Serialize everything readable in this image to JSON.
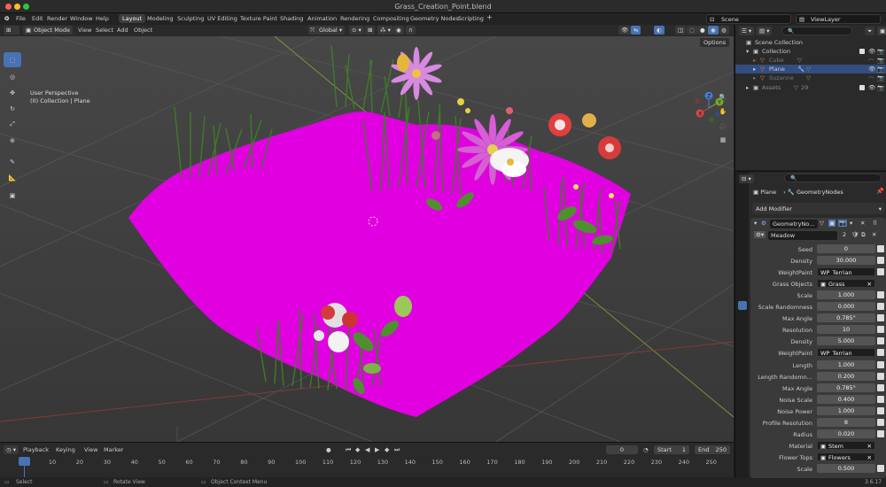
{
  "window": {
    "title": "Grass_Creation_Point.blend"
  },
  "menu": [
    "File",
    "Edit",
    "Render",
    "Window",
    "Help"
  ],
  "workspaces": [
    "Layout",
    "Modeling",
    "Sculpting",
    "UV Editing",
    "Texture Paint",
    "Shading",
    "Animation",
    "Rendering",
    "Compositing",
    "Geometry Nodes",
    "Scripting"
  ],
  "scene": "Scene",
  "view_layer": "ViewLayer",
  "header": {
    "mode": "Object Mode",
    "view": "View",
    "select": "Select",
    "add": "Add",
    "object": "Object",
    "orientation": "Global",
    "options": "Options"
  },
  "viewport": {
    "perspective": "User Perspective",
    "collection": "(0) Collection | Plane"
  },
  "gizmo": {
    "x": "X",
    "y": "Y",
    "z": "Z"
  },
  "timeline": {
    "playback": "Playback",
    "keying": "Keying",
    "view": "View",
    "marker": "Marker",
    "current": "0",
    "start_label": "Start",
    "start": "1",
    "end_label": "End",
    "end": "250",
    "ticks": [
      "0",
      "10",
      "20",
      "30",
      "40",
      "50",
      "60",
      "70",
      "80",
      "90",
      "100",
      "110",
      "120",
      "130",
      "140",
      "150",
      "160",
      "170",
      "180",
      "190",
      "200",
      "210",
      "220",
      "230",
      "240",
      "250"
    ]
  },
  "status": {
    "select": "Select",
    "rotate": "Rotate View",
    "context": "Object Context Menu",
    "version": "3.6.17"
  },
  "outliner": {
    "rows": [
      {
        "label": "Scene Collection",
        "extra": ""
      },
      {
        "label": "Collection",
        "extra": ""
      },
      {
        "label": "Cube",
        "extra": ""
      },
      {
        "label": "Plane",
        "extra": ""
      },
      {
        "label": "Suzanne",
        "extra": ""
      },
      {
        "label": "Assets",
        "extra": "29"
      }
    ]
  },
  "properties": {
    "breadcrumb_object": "Plane",
    "breadcrumb_modifier": "GeometryNodes",
    "add_modifier": "Add Modifier",
    "modifier_name": "GeometryNo...",
    "node_group": "Meadow",
    "node_users": "2",
    "params": [
      {
        "label": "Seed",
        "value": "0",
        "kind": "num"
      },
      {
        "label": "Density",
        "value": "30.000",
        "kind": "num"
      },
      {
        "label": "WeightPaint",
        "value": "WP_Terrian",
        "kind": "field"
      },
      {
        "label": "Grass Objects",
        "value": "Grass",
        "kind": "obj"
      },
      {
        "label": "Scale",
        "value": "1.000",
        "kind": "num"
      },
      {
        "label": "Scale Randomness",
        "value": "0.000",
        "kind": "num"
      },
      {
        "label": "Max Angle",
        "value": "0.785°",
        "kind": "num"
      },
      {
        "label": "Resolution",
        "value": "10",
        "kind": "num"
      },
      {
        "label": "Density",
        "value": "5.000",
        "kind": "num"
      },
      {
        "label": "WeightPaint",
        "value": "WP_Terrian",
        "kind": "field"
      },
      {
        "label": "Length",
        "value": "1.000",
        "kind": "num"
      },
      {
        "label": "Length Randomn...",
        "value": "0.200",
        "kind": "num"
      },
      {
        "label": "Max Angle",
        "value": "0.785°",
        "kind": "num"
      },
      {
        "label": "Noise Scale",
        "value": "0.400",
        "kind": "num"
      },
      {
        "label": "Noise Power",
        "value": "1.000",
        "kind": "num"
      },
      {
        "label": "Profile Resolution",
        "value": "8",
        "kind": "num"
      },
      {
        "label": "Radius",
        "value": "0.020",
        "kind": "num"
      },
      {
        "label": "Material",
        "value": "Stem",
        "kind": "obj"
      },
      {
        "label": "Flower Tops",
        "value": "Flowers",
        "kind": "obj"
      },
      {
        "label": "Scale",
        "value": "0.500",
        "kind": "num"
      }
    ]
  },
  "colors": {
    "accent": "#4772b3",
    "terrain": "#e000e0",
    "grass": "#3f7a2a",
    "viewport_bg": "#3d3d3d"
  }
}
